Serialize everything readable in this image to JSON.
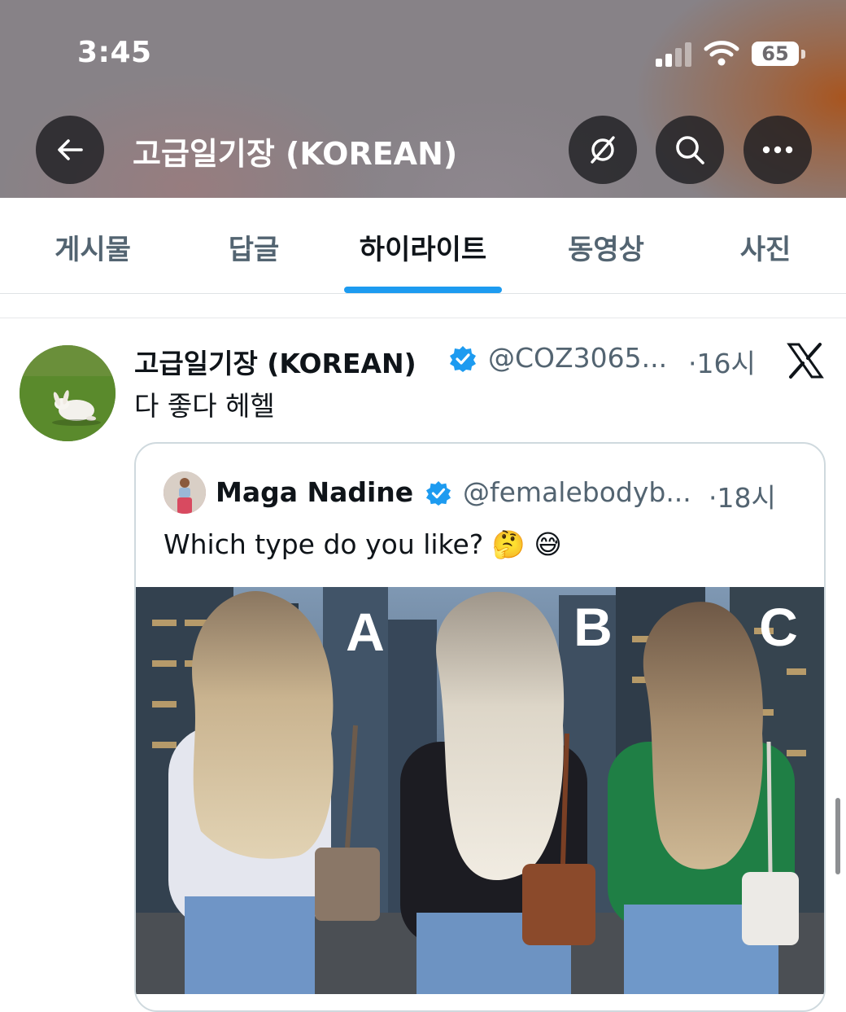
{
  "status_bar": {
    "time": "3:45",
    "battery": "65"
  },
  "header": {
    "title": "고급일기장 (KOREAN)",
    "icons": [
      "back-arrow-icon",
      "grok-icon",
      "search-icon",
      "more-icon"
    ]
  },
  "tabs": [
    {
      "label": "게시물",
      "active": false
    },
    {
      "label": "답글",
      "active": false
    },
    {
      "label": "하이라이트",
      "active": true
    },
    {
      "label": "동영상",
      "active": false
    },
    {
      "label": "사진",
      "active": false
    }
  ],
  "tweet": {
    "author": "고급일기장 (KOREAN)",
    "handle": "@COZ3065...",
    "time": "·16시",
    "text": "다 좋다 헤헬",
    "source_icon": "x-logo-icon"
  },
  "quote": {
    "author": "Maga Nadine",
    "handle": "@femalebodyb...",
    "time": "·18시",
    "text": "Which type do you like? 🤔 😅",
    "image_labels": [
      "A",
      "B",
      "C"
    ]
  },
  "colors": {
    "accent": "#1d9bf0",
    "text_primary": "#0f1419",
    "text_secondary": "#536471",
    "border": "#cfd9de"
  }
}
